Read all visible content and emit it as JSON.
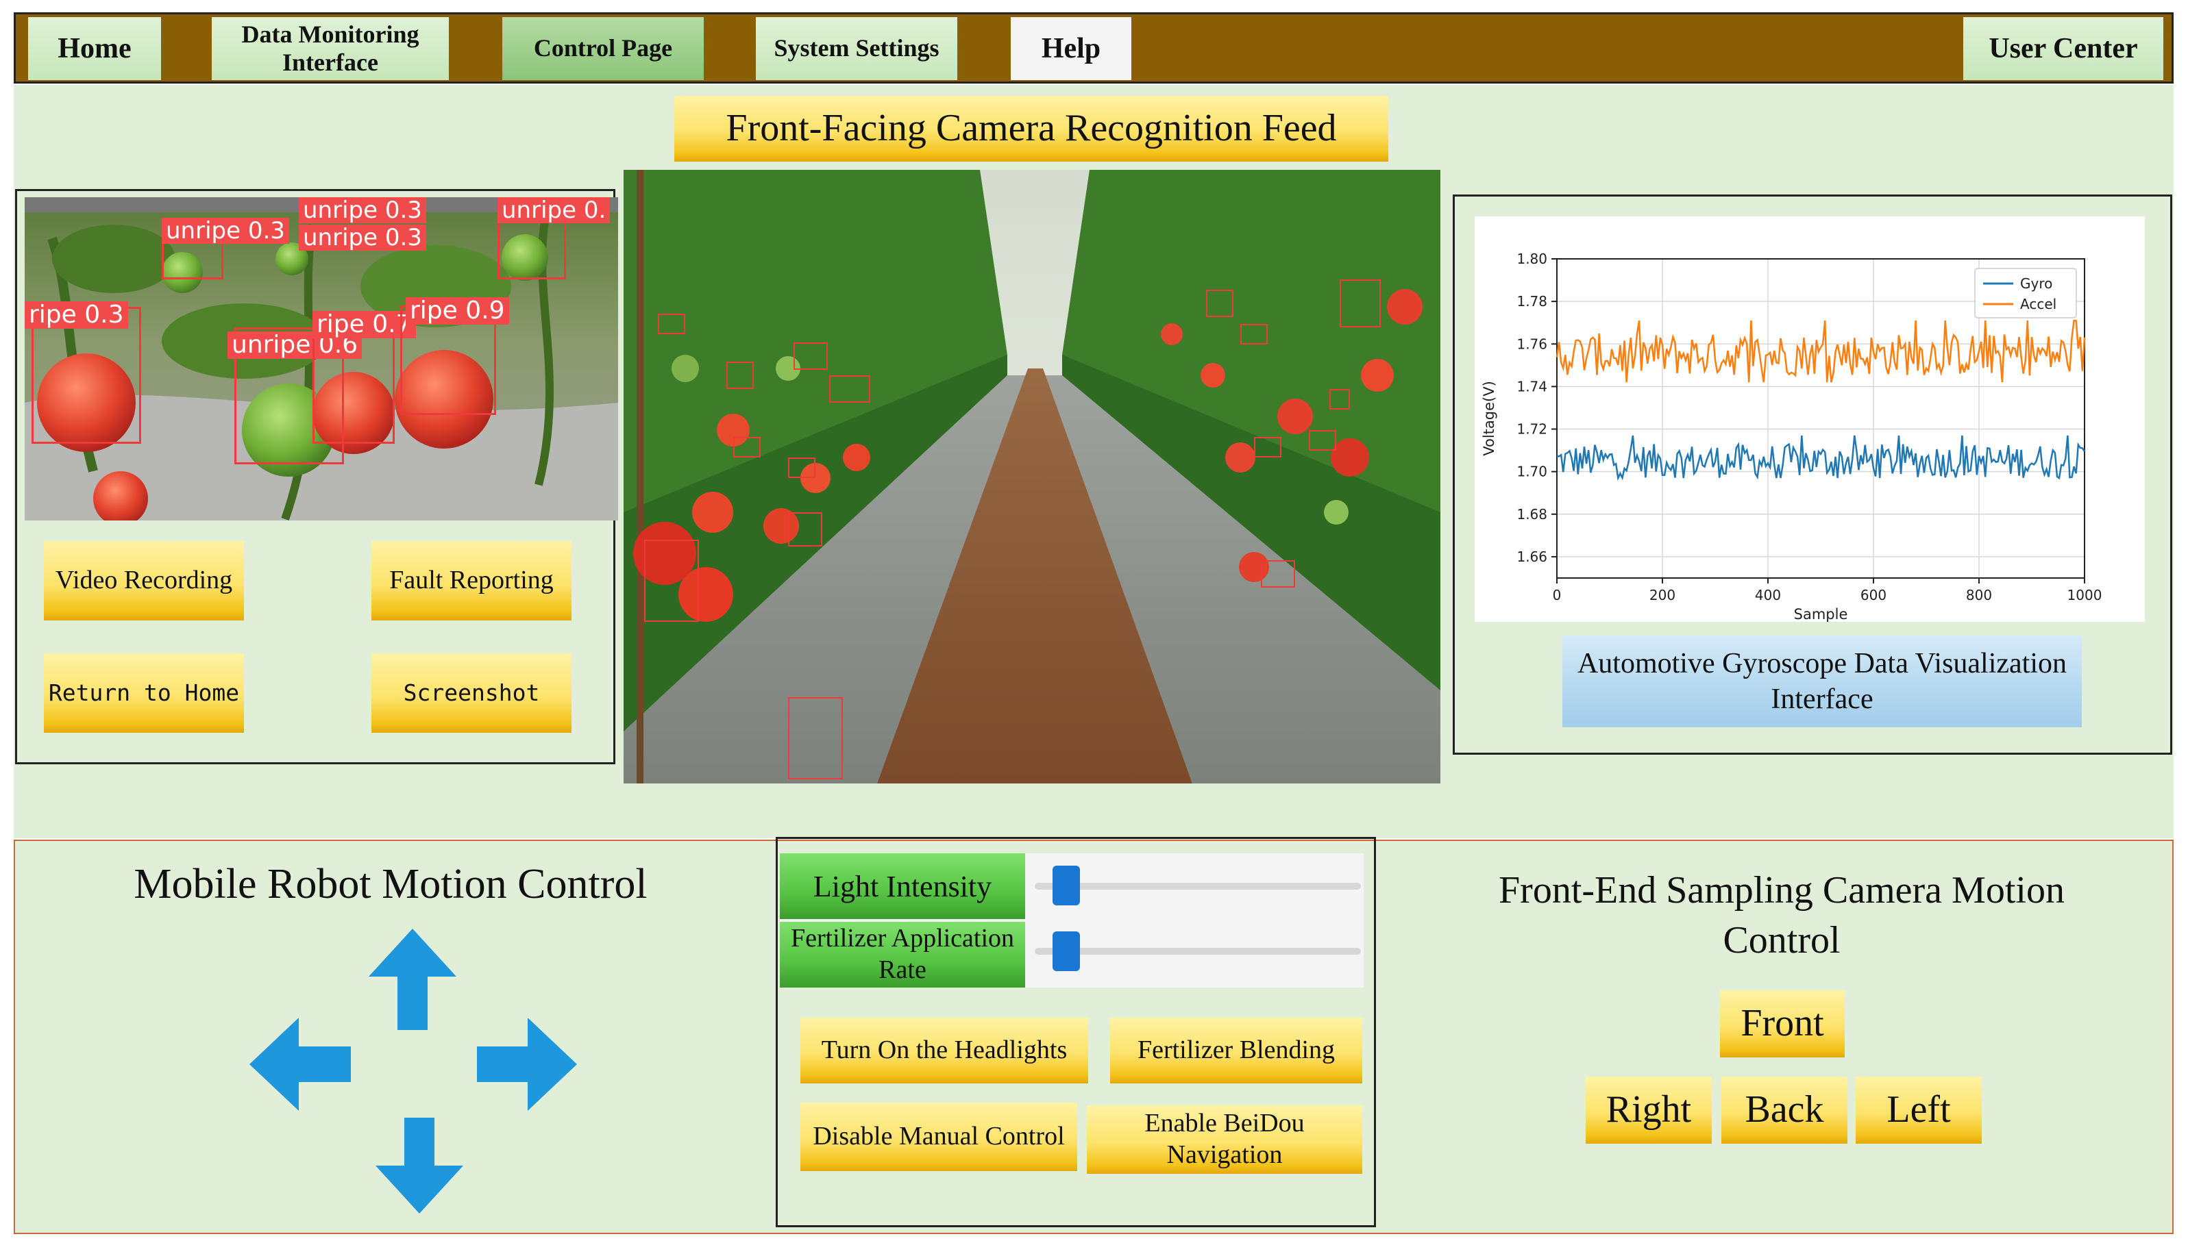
{
  "nav": {
    "home": "Home",
    "data_monitoring": "Data Monitoring Interface",
    "control_page": "Control Page",
    "system_settings": "System Settings",
    "help": "Help",
    "user_center": "User Center"
  },
  "camera_feed": {
    "title": "Front-Facing Camera Recognition Feed"
  },
  "left_panel": {
    "detections": [
      "unripe 0.3",
      "unripe 0.3",
      "unripe 0.3",
      "unripe 0.",
      "ripe 0.3",
      "ripe 0.7",
      "ripe 0.9",
      "unripe 0.6"
    ],
    "buttons": {
      "video_recording": "Video Recording",
      "fault_reporting": "Fault Reporting",
      "return_home": "Return to Home",
      "screenshot": "Screenshot"
    }
  },
  "gyro_panel": {
    "caption": "Automotive Gyroscope Data Visualization Interface"
  },
  "chart_data": {
    "type": "line",
    "xlabel": "Sample",
    "ylabel": "Voltage(V)",
    "xlim": [
      0,
      1000
    ],
    "ylim": [
      1.65,
      1.8
    ],
    "x_ticks": [
      0,
      200,
      400,
      600,
      800,
      1000
    ],
    "y_ticks": [
      1.66,
      1.68,
      1.7,
      1.72,
      1.74,
      1.76,
      1.78,
      1.8
    ],
    "legend_position": "top-right",
    "grid": true,
    "series": [
      {
        "name": "Gyro",
        "color": "#1f77b4",
        "mean": 1.705,
        "amplitude": 0.008,
        "min": 1.697,
        "max": 1.717
      },
      {
        "name": "Accel",
        "color": "#ff7f0e",
        "mean": 1.755,
        "amplitude": 0.01,
        "min": 1.742,
        "max": 1.781
      }
    ]
  },
  "motion_control": {
    "title": "Mobile Robot Motion Control"
  },
  "center_controls": {
    "light_intensity": "Light Intensity",
    "light_value": 0.06,
    "fertilizer_rate": "Fertilizer Application Rate",
    "fertilizer_value": 0.06,
    "buttons": {
      "headlights": "Turn On the Headlights",
      "fertilizer_blending": "Fertilizer Blending",
      "disable_manual": "Disable Manual Control",
      "beidou": "Enable BeiDou Navigation"
    }
  },
  "camera_control": {
    "title": "Front-End Sampling Camera Motion Control",
    "front": "Front",
    "right": "Right",
    "back": "Back",
    "left": "Left"
  },
  "colors": {
    "nav_bar": "#8a5e05",
    "panel_bg": "#e1eed8",
    "button_yellow": "#fde36b",
    "arrow_blue": "#1f97dc",
    "slider_blue": "#1976d2",
    "gyro_blue": "#1f77b4",
    "accel_orange": "#ff7f0e"
  }
}
